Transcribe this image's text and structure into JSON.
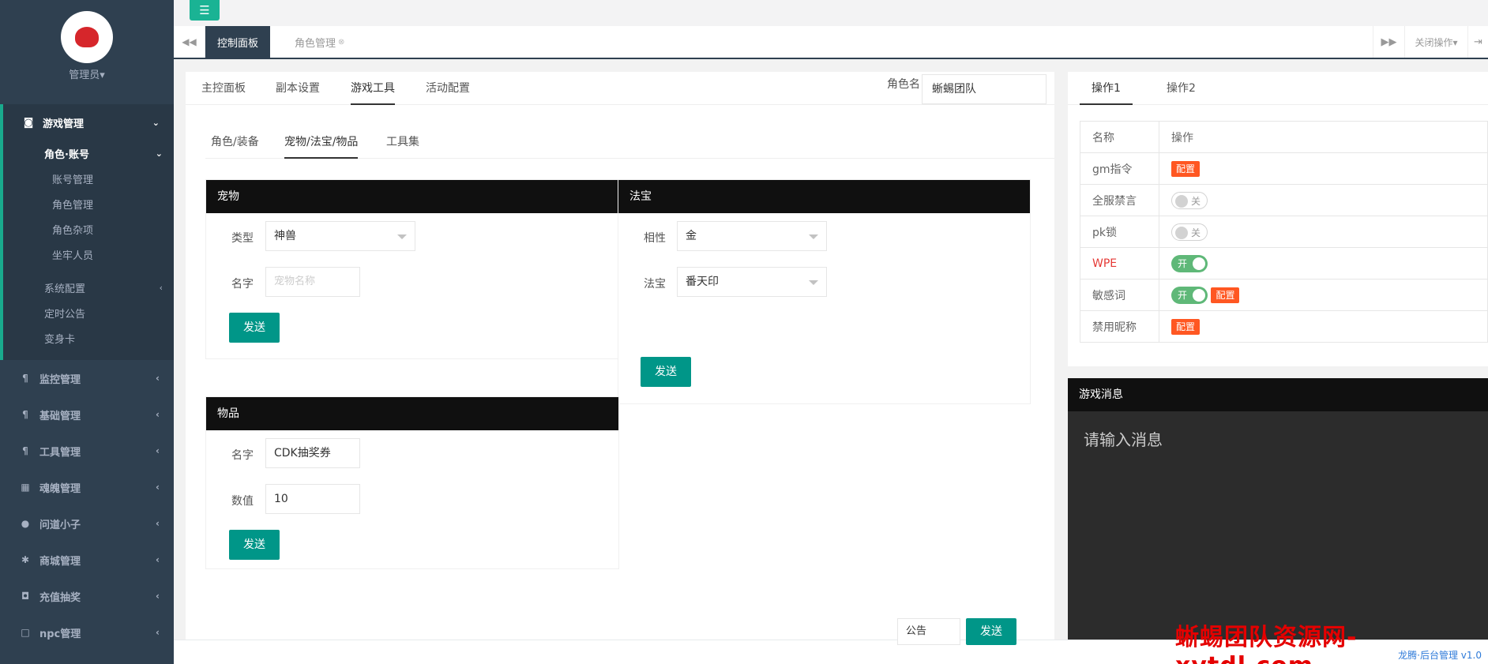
{
  "sidebar": {
    "admin_label": "管理员▾",
    "game_mgmt": "游戏管理",
    "role_account": "角色·账号",
    "account_mgmt": "账号管理",
    "role_mgmt": "角色管理",
    "role_misc": "角色杂项",
    "jailed": "坐牢人员",
    "system_config": "系统配置",
    "timed_notice": "定时公告",
    "transform_card": "变身卡",
    "monitor_mgmt": "监控管理",
    "basic_mgmt": "基础管理",
    "tool_mgmt": "工具管理",
    "soul_mgmt": "魂魄管理",
    "wendao": "问道小子",
    "shop_mgmt": "商城管理",
    "recharge": "充值抽奖",
    "npc_mgmt": "npc管理"
  },
  "topbar": {
    "menu_icon": "☰"
  },
  "tabbar": {
    "dashboard_tab": "控制面板",
    "role_tab": "角色管理",
    "close_ops": "关闭操作▾"
  },
  "main": {
    "tab_main": "主控面板",
    "tab_instance": "副本设置",
    "tab_tools": "游戏工具",
    "tab_activity": "活动配置",
    "role_label": "角色名",
    "role_value": "蜥蜴团队",
    "sub_role_equip": "角色/装备",
    "sub_pet": "宠物/法宝/物品",
    "sub_toolset": "工具集",
    "pet": {
      "title": "宠物",
      "type_label": "类型",
      "type_value": "神兽",
      "name_label": "名字",
      "name_placeholder": "宠物名称",
      "send": "发送"
    },
    "treasure": {
      "title": "法宝",
      "attr_label": "相性",
      "attr_value": "金",
      "treasure_label": "法宝",
      "treasure_value": "番天印",
      "send": "发送"
    },
    "item": {
      "title": "物品",
      "name_label": "名字",
      "name_value": "CDK抽奖券",
      "qty_label": "数值",
      "qty_value": "10",
      "send": "发送"
    }
  },
  "ops": {
    "tab1": "操作1",
    "tab2": "操作2",
    "col_name": "名称",
    "col_op": "操作",
    "rows": [
      {
        "name": "gm指令",
        "badge": "配置"
      },
      {
        "name": "全服禁言",
        "switch": "关"
      },
      {
        "name": "pk锁",
        "switch": "关"
      },
      {
        "name": "WPE",
        "switch": "开"
      },
      {
        "name": "敏感词",
        "switch": "开",
        "badge": "配置"
      },
      {
        "name": "禁用昵称",
        "badge": "配置"
      }
    ],
    "wpe_color": "#e53935"
  },
  "messages": {
    "title": "游戏消息",
    "placeholder": "请输入消息",
    "type_value": "公告",
    "send": "发送"
  },
  "footer": {
    "text": "龙腾·后台管理 v1.0"
  },
  "watermark": "蜥蜴团队资源网-xytdl.com",
  "colors": {
    "accent": "#009688",
    "sidebar": "#2f4050",
    "danger": "#ff5722",
    "switch_on": "#5fb878"
  }
}
